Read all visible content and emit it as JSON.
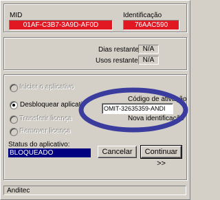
{
  "header": {
    "mid_label": "MID",
    "mid_value": "01AF-C3B7-3A9D-AF0D",
    "id_label": "Identificação",
    "id_value": "76AAC590"
  },
  "info": {
    "days_label": "Dias restantes:",
    "days_value": "N/A",
    "uses_label": "Usos restantes:",
    "uses_value": "N/A"
  },
  "options": {
    "start_app": "Iniciar o aplicativo",
    "unlock_app": "Desbloquear aplicati",
    "transfer_license": "Transferir licença",
    "remove_license": "Remover licença"
  },
  "activation": {
    "code_label": "Código de ativação",
    "code_value": "OMIT-32635359-ANDI",
    "new_id_label": "Nova identificação"
  },
  "status": {
    "label": "Status do aplicativo:",
    "value": "BLOQUEADO"
  },
  "buttons": {
    "cancel": "Cancelar",
    "continue": "Continuar >>"
  },
  "footer": {
    "company": "Anditec"
  },
  "colors": {
    "red_field": "#e11722",
    "status_bg": "#000080",
    "highlight_ring": "#3b3d9e"
  }
}
